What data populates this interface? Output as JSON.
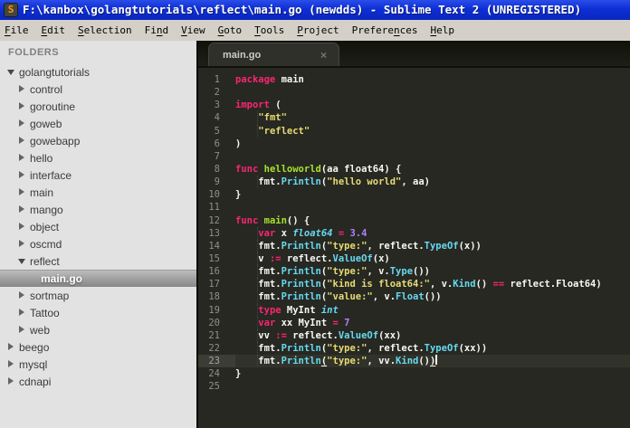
{
  "window": {
    "title": "F:\\kanbox\\golangtutorials\\reflect\\main.go (newdds) - Sublime Text 2 (UNREGISTERED)",
    "icon_letter": "S"
  },
  "menu": {
    "items": [
      {
        "label": "File",
        "underline": 0
      },
      {
        "label": "Edit",
        "underline": 0
      },
      {
        "label": "Selection",
        "underline": 0
      },
      {
        "label": "Find",
        "underline": 2
      },
      {
        "label": "View",
        "underline": 0
      },
      {
        "label": "Goto",
        "underline": 0
      },
      {
        "label": "Tools",
        "underline": 0
      },
      {
        "label": "Project",
        "underline": 0
      },
      {
        "label": "Preferences",
        "underline": 7
      },
      {
        "label": "Help",
        "underline": 0
      }
    ]
  },
  "sidebar": {
    "header": "FOLDERS",
    "tree": [
      {
        "label": "golangtutorials",
        "level": 0,
        "state": "expanded",
        "selected": false
      },
      {
        "label": "control",
        "level": 1,
        "state": "collapsed",
        "selected": false
      },
      {
        "label": "goroutine",
        "level": 1,
        "state": "collapsed",
        "selected": false
      },
      {
        "label": "goweb",
        "level": 1,
        "state": "collapsed",
        "selected": false
      },
      {
        "label": "gowebapp",
        "level": 1,
        "state": "collapsed",
        "selected": false
      },
      {
        "label": "hello",
        "level": 1,
        "state": "collapsed",
        "selected": false
      },
      {
        "label": "interface",
        "level": 1,
        "state": "collapsed",
        "selected": false
      },
      {
        "label": "main",
        "level": 1,
        "state": "collapsed",
        "selected": false
      },
      {
        "label": "mango",
        "level": 1,
        "state": "collapsed",
        "selected": false
      },
      {
        "label": "object",
        "level": 1,
        "state": "collapsed",
        "selected": false
      },
      {
        "label": "oscmd",
        "level": 1,
        "state": "collapsed",
        "selected": false
      },
      {
        "label": "reflect",
        "level": 1,
        "state": "expanded",
        "selected": false
      },
      {
        "label": "main.go",
        "level": 2,
        "state": "file",
        "selected": true
      },
      {
        "label": "sortmap",
        "level": 1,
        "state": "collapsed",
        "selected": false
      },
      {
        "label": "Tattoo",
        "level": 1,
        "state": "collapsed",
        "selected": false
      },
      {
        "label": "web",
        "level": 1,
        "state": "collapsed",
        "selected": false
      },
      {
        "label": "beego",
        "level": 0,
        "state": "collapsed",
        "selected": false
      },
      {
        "label": "mysql",
        "level": 0,
        "state": "collapsed",
        "selected": false
      },
      {
        "label": "cdnapi",
        "level": 0,
        "state": "collapsed",
        "selected": false
      }
    ]
  },
  "tabs": [
    {
      "label": "main.go",
      "close_glyph": "×",
      "active": true
    }
  ],
  "editor": {
    "current_line": 23,
    "cursor_line": 23,
    "lines": [
      {
        "num": 1,
        "tokens": [
          [
            "k",
            "package"
          ],
          [
            "p",
            " main"
          ]
        ]
      },
      {
        "num": 2,
        "tokens": []
      },
      {
        "num": 3,
        "tokens": [
          [
            "k",
            "import"
          ],
          [
            "p",
            " ("
          ]
        ]
      },
      {
        "num": 4,
        "tokens": [
          [
            "p",
            "    "
          ],
          [
            "s",
            "\"fmt\""
          ]
        ]
      },
      {
        "num": 5,
        "tokens": [
          [
            "p",
            "    "
          ],
          [
            "s",
            "\"reflect\""
          ]
        ]
      },
      {
        "num": 6,
        "tokens": [
          [
            "p",
            ")"
          ]
        ]
      },
      {
        "num": 7,
        "tokens": []
      },
      {
        "num": 8,
        "tokens": [
          [
            "k",
            "func"
          ],
          [
            "p",
            " "
          ],
          [
            "fn",
            "helloworld"
          ],
          [
            "p",
            "(aa float64) {"
          ]
        ]
      },
      {
        "num": 9,
        "tokens": [
          [
            "p",
            "    fmt."
          ],
          [
            "b",
            "Println"
          ],
          [
            "p",
            "("
          ],
          [
            "s",
            "\"hello world\""
          ],
          [
            "p",
            ", aa)"
          ]
        ]
      },
      {
        "num": 10,
        "tokens": [
          [
            "p",
            "}"
          ]
        ]
      },
      {
        "num": 11,
        "tokens": []
      },
      {
        "num": 12,
        "tokens": [
          [
            "k",
            "func"
          ],
          [
            "p",
            " "
          ],
          [
            "fn",
            "main"
          ],
          [
            "p",
            "() {"
          ]
        ]
      },
      {
        "num": 13,
        "tokens": [
          [
            "p",
            "    "
          ],
          [
            "k",
            "var"
          ],
          [
            "p",
            " x "
          ],
          [
            "t",
            "float64"
          ],
          [
            "p",
            " "
          ],
          [
            "k",
            "="
          ],
          [
            "p",
            " "
          ],
          [
            "n",
            "3.4"
          ]
        ]
      },
      {
        "num": 14,
        "tokens": [
          [
            "p",
            "    fmt."
          ],
          [
            "b",
            "Println"
          ],
          [
            "p",
            "("
          ],
          [
            "s",
            "\"type:\""
          ],
          [
            "p",
            ", reflect."
          ],
          [
            "b",
            "TypeOf"
          ],
          [
            "p",
            "(x))"
          ]
        ]
      },
      {
        "num": 15,
        "tokens": [
          [
            "p",
            "    v "
          ],
          [
            "k",
            ":="
          ],
          [
            "p",
            " reflect."
          ],
          [
            "b",
            "ValueOf"
          ],
          [
            "p",
            "(x)"
          ]
        ]
      },
      {
        "num": 16,
        "tokens": [
          [
            "p",
            "    fmt."
          ],
          [
            "b",
            "Println"
          ],
          [
            "p",
            "("
          ],
          [
            "s",
            "\"type:\""
          ],
          [
            "p",
            ", v."
          ],
          [
            "b",
            "Type"
          ],
          [
            "p",
            "())"
          ]
        ]
      },
      {
        "num": 17,
        "tokens": [
          [
            "p",
            "    fmt."
          ],
          [
            "b",
            "Println"
          ],
          [
            "p",
            "("
          ],
          [
            "s",
            "\"kind is float64:\""
          ],
          [
            "p",
            ", v."
          ],
          [
            "b",
            "Kind"
          ],
          [
            "p",
            "() "
          ],
          [
            "k",
            "=="
          ],
          [
            "p",
            " reflect.Float64)"
          ]
        ]
      },
      {
        "num": 18,
        "tokens": [
          [
            "p",
            "    fmt."
          ],
          [
            "b",
            "Println"
          ],
          [
            "p",
            "("
          ],
          [
            "s",
            "\"value:\""
          ],
          [
            "p",
            ", v."
          ],
          [
            "b",
            "Float"
          ],
          [
            "p",
            "())"
          ]
        ]
      },
      {
        "num": 19,
        "tokens": [
          [
            "p",
            "    "
          ],
          [
            "k",
            "type"
          ],
          [
            "p",
            " MyInt "
          ],
          [
            "t",
            "int"
          ]
        ]
      },
      {
        "num": 20,
        "tokens": [
          [
            "p",
            "    "
          ],
          [
            "k",
            "var"
          ],
          [
            "p",
            " xx MyInt "
          ],
          [
            "k",
            "="
          ],
          [
            "p",
            " "
          ],
          [
            "n",
            "7"
          ]
        ]
      },
      {
        "num": 21,
        "tokens": [
          [
            "p",
            "    vv "
          ],
          [
            "k",
            ":="
          ],
          [
            "p",
            " reflect."
          ],
          [
            "b",
            "ValueOf"
          ],
          [
            "p",
            "(xx)"
          ]
        ]
      },
      {
        "num": 22,
        "tokens": [
          [
            "p",
            "    fmt."
          ],
          [
            "b",
            "Println"
          ],
          [
            "p",
            "("
          ],
          [
            "s",
            "\"type:\""
          ],
          [
            "p",
            ", reflect."
          ],
          [
            "b",
            "TypeOf"
          ],
          [
            "p",
            "(xx))"
          ]
        ]
      },
      {
        "num": 23,
        "tokens": [
          [
            "p",
            "    fmt."
          ],
          [
            "b",
            "Println"
          ],
          [
            "u",
            "("
          ],
          [
            "s",
            "\"type:\""
          ],
          [
            "p",
            ", vv."
          ],
          [
            "b",
            "Kind"
          ],
          [
            "p",
            "()"
          ],
          [
            "u",
            ")"
          ]
        ]
      },
      {
        "num": 24,
        "tokens": [
          [
            "p",
            "}"
          ]
        ]
      },
      {
        "num": 25,
        "tokens": []
      }
    ]
  },
  "colors": {
    "titlebar": "#0d2fd6",
    "menubar_bg": "#d4d0c8",
    "sidebar_bg": "#e2e2e2",
    "editor_bg": "#272822",
    "tabbar_bg": "#1a1b15",
    "keyword": "#f92672",
    "string": "#e6db74",
    "function": "#a6e22e",
    "builtin": "#66d9ef",
    "number": "#ae81ff",
    "plain": "#f8f8f2",
    "line_number": "#8f908a",
    "current_line": "#31322a",
    "current_gutter": "#3c3d34",
    "sel_top": "#bdbdbd",
    "sel_bottom": "#878787"
  }
}
